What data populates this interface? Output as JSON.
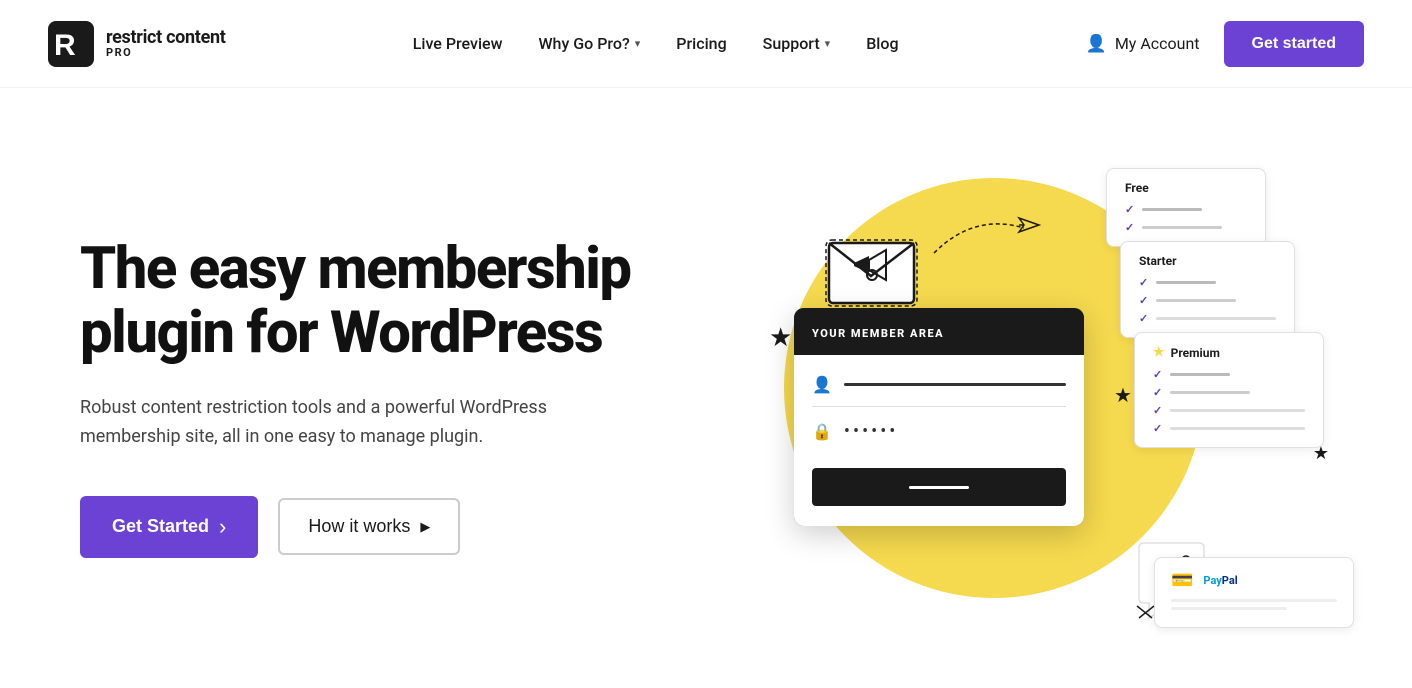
{
  "header": {
    "logo_main": "restrict content",
    "logo_pro": "PRO",
    "nav": [
      {
        "id": "live-preview",
        "label": "Live Preview",
        "has_dropdown": false
      },
      {
        "id": "why-go-pro",
        "label": "Why Go Pro?",
        "has_dropdown": true
      },
      {
        "id": "pricing",
        "label": "Pricing",
        "has_dropdown": false
      },
      {
        "id": "support",
        "label": "Support",
        "has_dropdown": true
      },
      {
        "id": "blog",
        "label": "Blog",
        "has_dropdown": false
      }
    ],
    "my_account_label": "My Account",
    "get_started_label": "Get started"
  },
  "hero": {
    "headline_line1": "The easy membership",
    "headline_line2": "plugin for WordPress",
    "subtext": "Robust content restriction tools and a powerful WordPress membership site, all in one easy to manage plugin.",
    "cta_primary": "Get Started",
    "cta_secondary": "How it works",
    "member_area_label": "YOUR MEMBER AREA",
    "pricing_tiers": [
      {
        "label": "Free",
        "has_star": false
      },
      {
        "label": "Starter",
        "has_star": false
      },
      {
        "label": "Premium",
        "has_star": true
      }
    ]
  },
  "icons": {
    "chevron_down": "▾",
    "user": "👤",
    "arrow_right": "›",
    "triangle_right": "▶",
    "check": "✓",
    "star": "★",
    "star_black": "★"
  }
}
